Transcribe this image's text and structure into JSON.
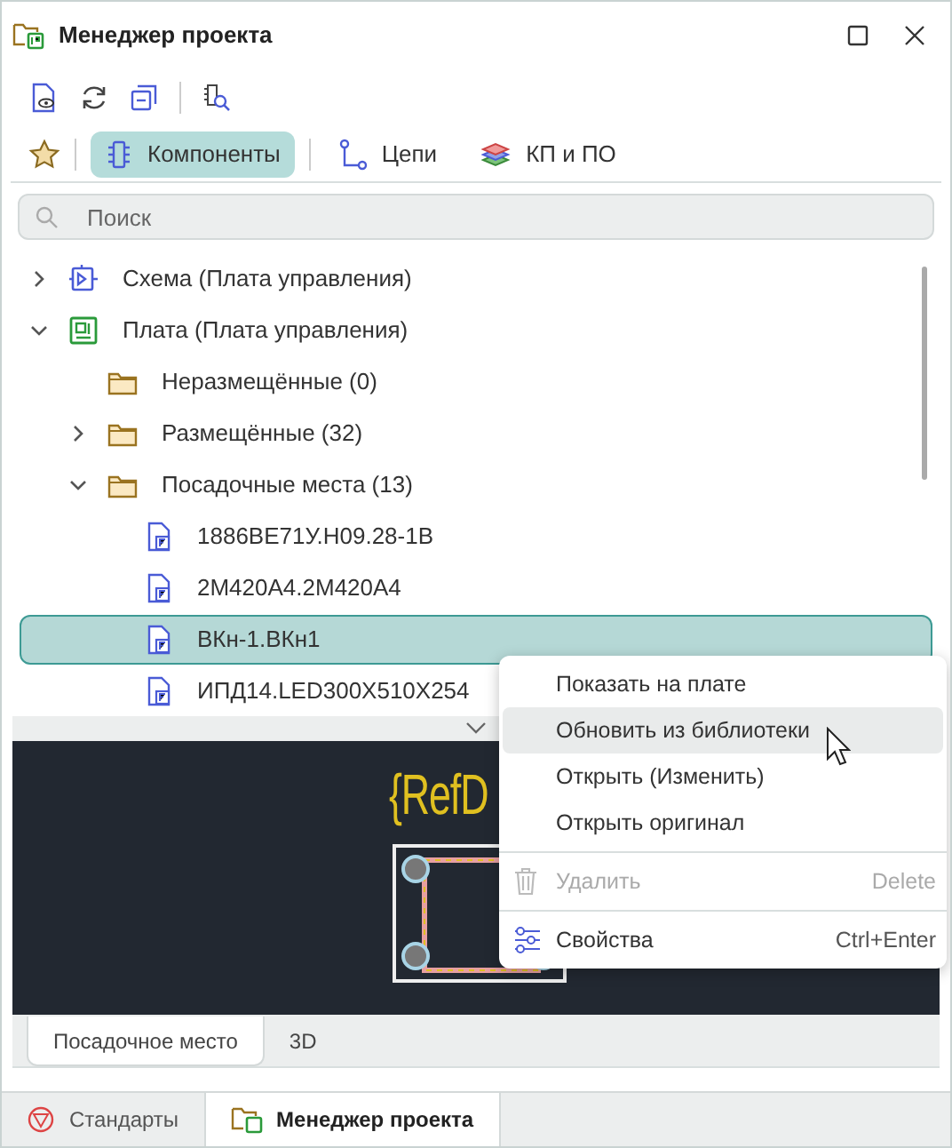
{
  "window": {
    "title": "Менеджер проекта"
  },
  "view_tabs": [
    {
      "label": "Компоненты",
      "kind": "chip",
      "selected": true
    },
    {
      "label": "Цепи",
      "kind": "net",
      "selected": false
    },
    {
      "label": "КП и ПО",
      "kind": "layers",
      "selected": false
    }
  ],
  "search": {
    "placeholder": "Поиск"
  },
  "tree": [
    {
      "label": "Схема (Плата управления)",
      "kind": "schematic",
      "expanded": false,
      "selected": false
    },
    {
      "label": "Плата (Плата управления)",
      "kind": "board",
      "expanded": true,
      "selected": false,
      "children": [
        {
          "label": "Неразмещённые (0)",
          "kind": "folder",
          "selected": false
        },
        {
          "label": "Размещённые (32)",
          "kind": "folder",
          "expanded": false,
          "selected": false
        },
        {
          "label": "Посадочные места (13)",
          "kind": "folder",
          "expanded": true,
          "selected": false,
          "children": [
            {
              "label": "1886ВЕ71У.Н09.28-1В",
              "kind": "footprint",
              "selected": false
            },
            {
              "label": "2М420А4.2М420А4",
              "kind": "footprint",
              "selected": false
            },
            {
              "label": "ВКн-1.ВКн1",
              "kind": "footprint",
              "selected": true
            },
            {
              "label": "ИПД14.LED300X510X254",
              "kind": "footprint",
              "selected": false
            }
          ]
        }
      ]
    }
  ],
  "preview": {
    "ref_text": "{RefD"
  },
  "preview_tabs": [
    {
      "label": "Посадочное место",
      "selected": true
    },
    {
      "label": "3D",
      "selected": false
    }
  ],
  "context_menu": [
    [
      {
        "label": "Показать на плате",
        "highlighted": false,
        "disabled": false
      },
      {
        "label": "Обновить из библиотеки",
        "highlighted": true,
        "disabled": false
      },
      {
        "label": "Открыть (Изменить)",
        "highlighted": false,
        "disabled": false
      },
      {
        "label": "Открыть оригинал",
        "highlighted": false,
        "disabled": false
      }
    ],
    [
      {
        "label": "Удалить",
        "shortcut": "Delete",
        "kind": "delete",
        "highlighted": false,
        "disabled": true
      }
    ],
    [
      {
        "label": "Свойства",
        "shortcut": "Ctrl+Enter",
        "kind": "properties",
        "highlighted": false,
        "disabled": false
      }
    ]
  ],
  "footer_tabs": [
    {
      "label": "Стандарты",
      "kind": "standards",
      "selected": false
    },
    {
      "label": "Менеджер проекта",
      "kind": "project",
      "selected": true
    }
  ]
}
